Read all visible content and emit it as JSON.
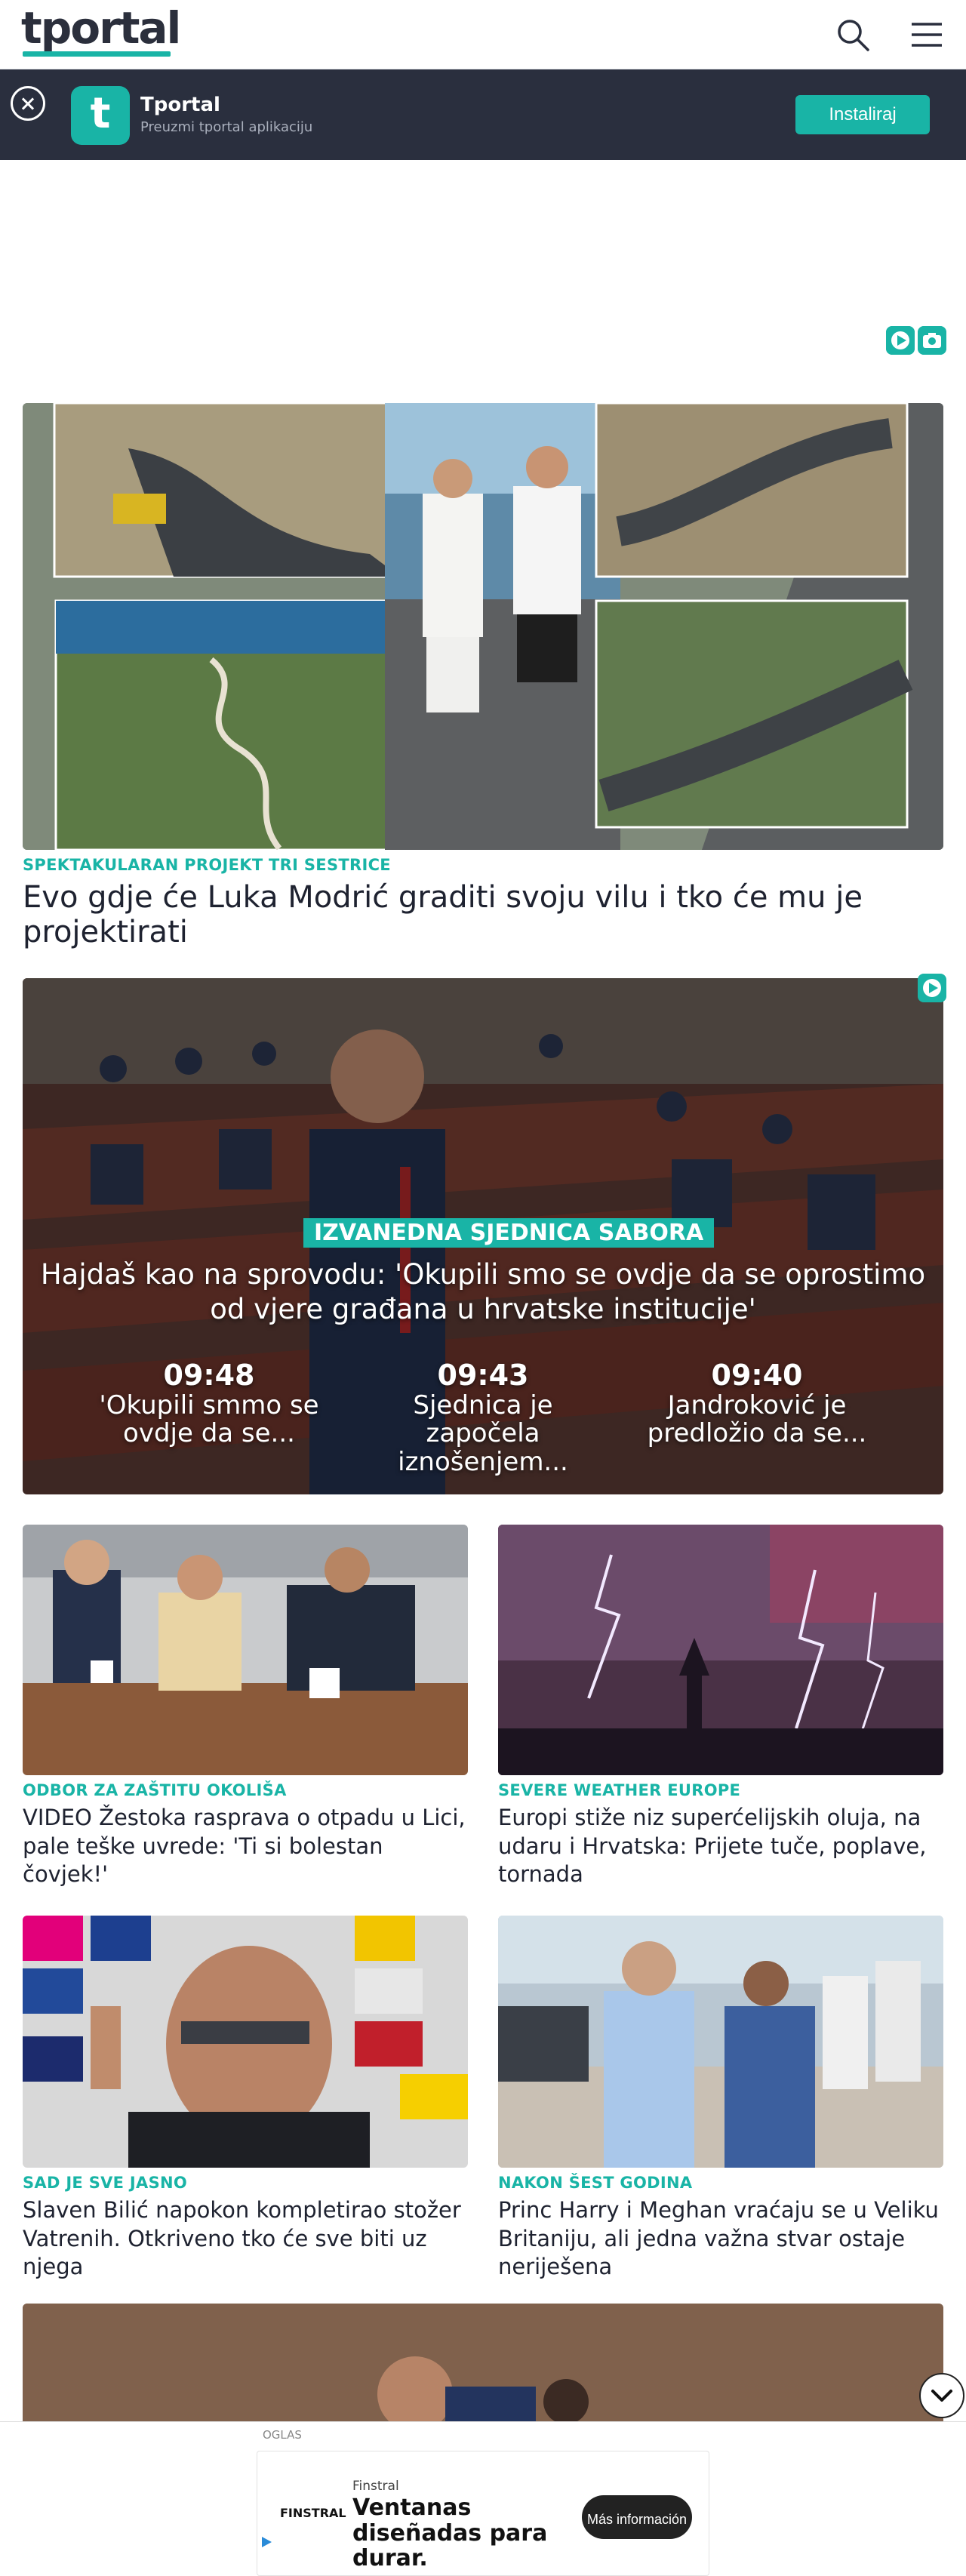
{
  "header": {
    "logo": "tportal"
  },
  "app_banner": {
    "app_name": "Tportal",
    "app_subtitle": "Preuzmi tportal aplikaciju",
    "install_label": "Instaliraj"
  },
  "articles": [
    {
      "kicker": "SPEKTAKULARAN PROJEKT TRI SESTRICE",
      "title": "Evo gdje će Luka Modrić graditi svoju vilu i tko će mu je projektirati"
    },
    {
      "kicker": "ODBOR ZA ZAŠTITU OKOLIŠA",
      "title": "VIDEO Žestoka rasprava o otpadu u Lici, pale teške uvrede: 'Ti si bolestan čovjek!'"
    },
    {
      "kicker": "SEVERE WEATHER EUROPE",
      "title": "Europi stiže niz superćelijskih oluja, na udaru i Hrvatska: Prijete tuče, poplave, tornada"
    },
    {
      "kicker": "SAD JE SVE JASNO",
      "title": "Slaven Bilić napokon kompletirao stožer Vatrenih. Otkriveno tko će sve biti uz njega"
    },
    {
      "kicker": "NAKON ŠEST GODINA",
      "title": "Princ Harry i Meghan vraćaju se u Veliku Britaniju, ali jedna važna stvar ostaje neriješena"
    }
  ],
  "live": {
    "kicker": "IZVANEDNA SJEDNICA SABORA",
    "title": "Hajdaš kao na sprovodu: 'Okupili smo se ovdje da se oprostimo od vjere građana u hrvatske institucije'",
    "items": [
      {
        "time": "09:48",
        "text": "'Okupili smmo se ovdje da se..."
      },
      {
        "time": "09:43",
        "text": "Sjednica je započela iznošenjem..."
      },
      {
        "time": "09:40",
        "text": "Jandroković je predložio da se..."
      }
    ]
  },
  "bottom_ad": {
    "label": "OGLAS",
    "brand": "Finstral",
    "brand_logo": "FINSTRAL",
    "headline": "Ventanas diseñadas para durar.",
    "cta": "Más información"
  },
  "colors": {
    "accent": "#19b4a6",
    "banner_bg": "#2a2f3e",
    "text": "#1e2230"
  }
}
